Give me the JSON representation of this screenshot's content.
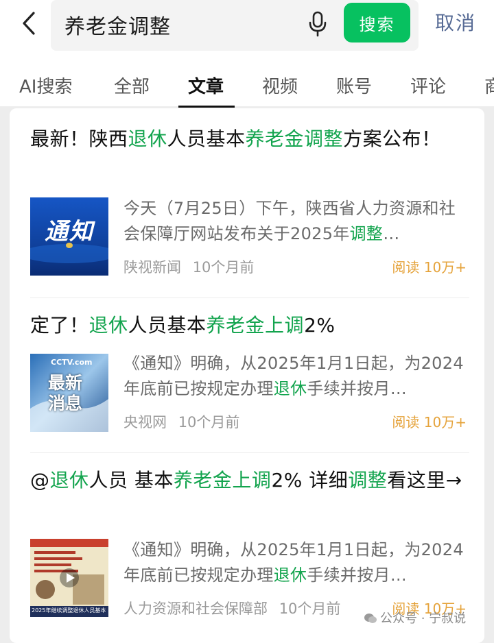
{
  "search": {
    "query": "养老金调整",
    "button_label": "搜索",
    "cancel_label": "取消"
  },
  "tabs": [
    {
      "label": "AI搜索"
    },
    {
      "label": "全部"
    },
    {
      "label": "文章",
      "active": true
    },
    {
      "label": "视频"
    },
    {
      "label": "账号"
    },
    {
      "label": "评论"
    },
    {
      "label": "商"
    }
  ],
  "articles": [
    {
      "title_parts": [
        "最新！陕西",
        "退休",
        "人员基本",
        "养老金调整",
        "方案公布！"
      ],
      "summary_plain": "今天（7月25日）下午，陕西省人力资源和社会保障厅网站发布关于2025年",
      "summary_hl": "调整",
      "summary_tail": "…",
      "source": "陕视新闻",
      "time": "10个月前",
      "reads": "阅读 10万+",
      "thumb_text": "通知"
    },
    {
      "title_parts": [
        "定了！",
        "退休",
        "人员基本",
        "养老金上调",
        "2%"
      ],
      "summary_plain": "《通知》明确，从2025年1月1日起，为2024年底前已按规定办理",
      "summary_hl": "退休",
      "summary_tail": "手续并按月…",
      "source": "央视网",
      "time": "10个月前",
      "reads": "阅读 10万+",
      "thumb_text": "最新消息",
      "thumb_logo": "CCTV.com"
    },
    {
      "title_parts": [
        "@",
        "退休",
        "人员 基本",
        "养老金上调",
        "2% 详细",
        "调整",
        "看这里→"
      ],
      "summary_plain": "《通知》明确，从2025年1月1日起，为2024年底前已按规定办理",
      "summary_hl": "退休",
      "summary_tail": "手续并按月…",
      "source": "人力资源和社会保障部",
      "time": "10个月前",
      "reads": "阅读 10万+",
      "thumb_caption": "2025年继续调整退休人员基本"
    }
  ],
  "watermark": "公众号 · 宁叔说",
  "colors": {
    "accent": "#07c160",
    "highlight": "#13a44e",
    "reads": "#e5a33b",
    "cancel": "#576b95"
  },
  "icons": [
    "back-arrow-icon",
    "microphone-icon",
    "play-icon",
    "wechat-icon"
  ]
}
